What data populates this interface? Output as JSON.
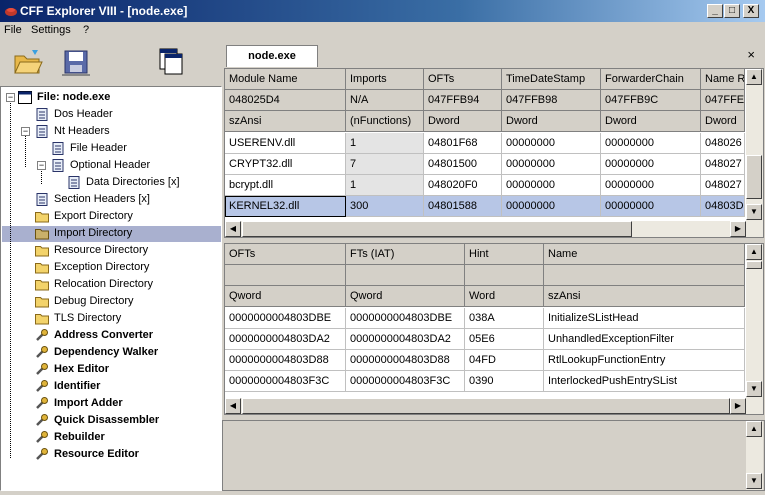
{
  "window": {
    "title": "CFF Explorer VIII - [node.exe]",
    "min": "_",
    "max": "□",
    "close": "X"
  },
  "menu": [
    "File",
    "Settings",
    "?"
  ],
  "toolbar": [
    "open-folder-icon",
    "save-icon",
    "windows-icon"
  ],
  "tree": [
    {
      "label": "File: node.exe",
      "icon": "file-icon",
      "bold": true
    },
    {
      "label": "Dos Header",
      "icon": "page-icon"
    },
    {
      "label": "Nt Headers",
      "icon": "page-icon"
    },
    {
      "label": "File Header",
      "icon": "page-icon"
    },
    {
      "label": "Optional Header",
      "icon": "page-icon"
    },
    {
      "label": "Data Directories [x]",
      "icon": "page-icon"
    },
    {
      "label": "Section Headers [x]",
      "icon": "page-icon"
    },
    {
      "label": "Export Directory",
      "icon": "folder-icon"
    },
    {
      "label": "Import Directory",
      "icon": "folder-icon"
    },
    {
      "label": "Resource Directory",
      "icon": "folder-icon"
    },
    {
      "label": "Exception Directory",
      "icon": "folder-icon"
    },
    {
      "label": "Relocation Directory",
      "icon": "folder-icon"
    },
    {
      "label": "Debug Directory",
      "icon": "folder-icon"
    },
    {
      "label": "TLS Directory",
      "icon": "folder-icon"
    },
    {
      "label": "Address Converter",
      "icon": "tool-icon",
      "bold": true
    },
    {
      "label": "Dependency Walker",
      "icon": "tool-icon",
      "bold": true
    },
    {
      "label": "Hex Editor",
      "icon": "tool-icon",
      "bold": true
    },
    {
      "label": "Identifier",
      "icon": "tool-icon",
      "bold": true
    },
    {
      "label": "Import Adder",
      "icon": "tool-icon",
      "bold": true
    },
    {
      "label": "Quick Disassembler",
      "icon": "tool-icon",
      "bold": true
    },
    {
      "label": "Rebuilder",
      "icon": "tool-icon",
      "bold": true
    },
    {
      "label": "Resource Editor",
      "icon": "tool-icon",
      "bold": true
    }
  ],
  "tab": {
    "label": "node.exe",
    "close": "×"
  },
  "imports_table": {
    "headers": [
      "Module Name",
      "Imports",
      "OFTs",
      "TimeDateStamp",
      "ForwarderChain",
      "Name R"
    ],
    "offsets": [
      "048025D4",
      "N/A",
      "047FFB94",
      "047FFB98",
      "047FFB9C",
      "047FFE"
    ],
    "types": [
      "szAnsi",
      "(nFunctions)",
      "Dword",
      "Dword",
      "Dword",
      "Dword"
    ],
    "rows": [
      [
        "USERENV.dll",
        "1",
        "04801F68",
        "00000000",
        "00000000",
        "048026"
      ],
      [
        "CRYPT32.dll",
        "7",
        "04801500",
        "00000000",
        "00000000",
        "048027"
      ],
      [
        "bcrypt.dll",
        "1",
        "048020F0",
        "00000000",
        "00000000",
        "048027"
      ],
      [
        "KERNEL32.dll",
        "300",
        "04801588",
        "00000000",
        "00000000",
        "04803D"
      ]
    ]
  },
  "functions_table": {
    "headers": [
      "OFTs",
      "FTs (IAT)",
      "Hint",
      "Name"
    ],
    "types": [
      "Qword",
      "Qword",
      "Word",
      "szAnsi"
    ],
    "rows": [
      [
        "0000000004803DBE",
        "0000000004803DBE",
        "038A",
        "InitializeSListHead"
      ],
      [
        "0000000004803DA2",
        "0000000004803DA2",
        "05E6",
        "UnhandledExceptionFilter"
      ],
      [
        "0000000004803D88",
        "0000000004803D88",
        "04FD",
        "RtlLookupFunctionEntry"
      ],
      [
        "0000000004803F3C",
        "0000000004803F3C",
        "0390",
        "InterlockedPushEntrySList"
      ]
    ]
  }
}
